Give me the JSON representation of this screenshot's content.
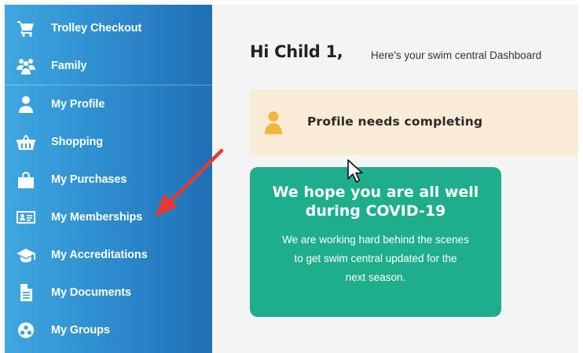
{
  "sidebar": {
    "items": [
      {
        "label": "Trolley Checkout",
        "icon": "cart-icon"
      },
      {
        "label": "Family",
        "icon": "family-icon"
      },
      {
        "label": "My Profile",
        "icon": "user-icon"
      },
      {
        "label": "Shopping",
        "icon": "basket-icon"
      },
      {
        "label": "My Purchases",
        "icon": "bag-icon"
      },
      {
        "label": "My Memberships",
        "icon": "id-card-icon"
      },
      {
        "label": "My Accreditations",
        "icon": "graduation-cap-icon"
      },
      {
        "label": "My Documents",
        "icon": "document-icon"
      },
      {
        "label": "My Groups",
        "icon": "groups-icon"
      }
    ]
  },
  "main": {
    "greeting": "Hi Child 1,",
    "greeting_sub": "Here's your swim central Dashboard",
    "profile_banner": {
      "text": "Profile needs completing",
      "icon": "user-icon"
    },
    "covid_card": {
      "title_line1": "We hope you are all well",
      "title_line2": "during COVID-19",
      "body_line1": "We are working hard behind the scenes",
      "body_line2": "to get swim central updated for the",
      "body_line3": "next season."
    }
  },
  "colors": {
    "sidebar_start": "#3fa7e0",
    "sidebar_end": "#1f6fb4",
    "banner_bg": "#faebd6",
    "banner_icon": "#f2b63c",
    "card_bg": "#1fae8c",
    "annotation_arrow": "#e53935"
  }
}
